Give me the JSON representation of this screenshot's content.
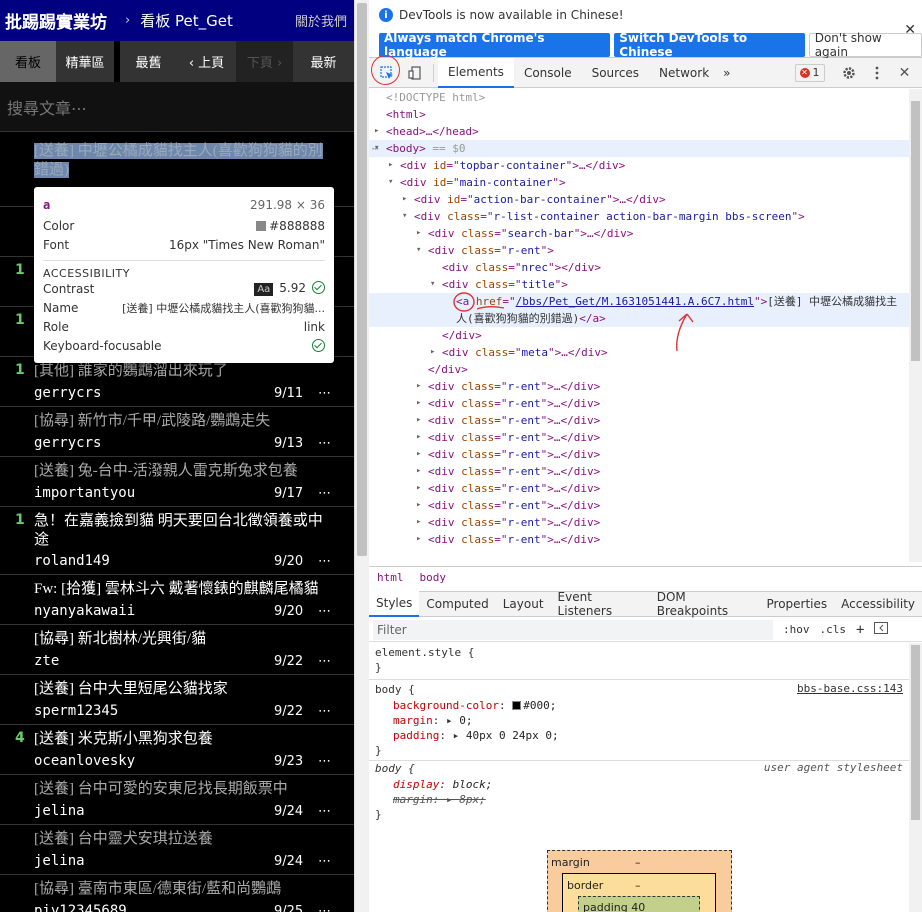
{
  "ptt": {
    "site_name": "批踢踢實業坊",
    "separator": "›",
    "board_label": "看板 Pet_Get",
    "about": "關於我們",
    "actions": {
      "board": "看板",
      "digest": "精華區",
      "oldest": "最舊",
      "prev": "‹ 上頁",
      "next": "下頁 ›",
      "latest": "最新"
    },
    "search_placeholder": "搜尋文章⋯",
    "more_symbol": "⋯",
    "highlight_title": "[送養] 中壢公橘成貓找主人(喜歡狗狗貓的別錯過)",
    "rows": [
      {
        "nrec": "1",
        "nrec_color": "#6c6",
        "title": "",
        "author": "",
        "date": ""
      },
      {
        "nrec": "1",
        "nrec_color": "#6c6",
        "title": "",
        "author": "",
        "date": ""
      },
      {
        "nrec": "1",
        "nrec_color": "#6c6",
        "title": "[其他] 誰家的鸚鵡溜出來玩了",
        "author": "gerrycrs",
        "date": "9/11"
      },
      {
        "nrec": "",
        "nrec_color": "#6c6",
        "title": "[協尋] 新竹市/千甲/武陵路/鸚鵡走失",
        "author": "gerrycrs",
        "date": "9/13"
      },
      {
        "nrec": "",
        "nrec_color": "#6c6",
        "title": "[送養] 兔-台中-活潑親人雷克斯兔求包養",
        "author": "importantyou",
        "date": "9/17"
      },
      {
        "nrec": "1",
        "nrec_color": "#6c6",
        "title": "急！在嘉義撿到貓 明天要回台北徵領養或中途",
        "author": "roland149",
        "date": "9/20",
        "bright": true
      },
      {
        "nrec": "",
        "nrec_color": "#6c6",
        "title": "Fw: [拾獲] 雲林斗六 戴著懷錶的麒麟尾橘貓",
        "author": "nyanyakawaii",
        "date": "9/20",
        "bright": true
      },
      {
        "nrec": "",
        "nrec_color": "#6c6",
        "title": "[協尋] 新北樹林/光興街/貓",
        "author": "zte",
        "date": "9/22",
        "bright": true
      },
      {
        "nrec": "",
        "nrec_color": "#6c6",
        "title": "[送養] 台中大里短尾公貓找家",
        "author": "sperm12345",
        "date": "9/22",
        "bright": true
      },
      {
        "nrec": "4",
        "nrec_color": "#6c6",
        "title": "[送養] 米克斯小黑狗求包養",
        "author": "oceanlovesky",
        "date": "9/23",
        "bright": true
      },
      {
        "nrec": "",
        "nrec_color": "#6c6",
        "title": "[送養] 台中可愛的安東尼找長期飯票中",
        "author": "jelina",
        "date": "9/24"
      },
      {
        "nrec": "",
        "nrec_color": "#6c6",
        "title": "[送養] 台中靈犬安琪拉送養",
        "author": "jelina",
        "date": "9/24"
      },
      {
        "nrec": "",
        "nrec_color": "#6c6",
        "title": "[協尋] 臺南市東區/德東街/藍和尚鸚鵡",
        "author": "piy12345689",
        "date": "9/25"
      }
    ],
    "tooltip": {
      "tag": "a",
      "size": "291.98 × 36",
      "color_label": "Color",
      "color_value": "#888888",
      "font_label": "Font",
      "font_value": "16px \"Times New Roman\"",
      "section": "ACCESSIBILITY",
      "contrast_label": "Contrast",
      "contrast_aa": "Aa",
      "contrast_value": "5.92",
      "name_label": "Name",
      "name_value": "[送養] 中壢公橘成貓找主人(喜歡狗狗貓...",
      "role_label": "Role",
      "role_value": "link",
      "keyboard_label": "Keyboard-focusable"
    }
  },
  "devtools": {
    "info_message": "DevTools is now available in Chinese!",
    "btn_match": "Always match Chrome's language",
    "btn_switch": "Switch DevTools to Chinese",
    "btn_dont_show": "Don't show again",
    "tabs": [
      "Elements",
      "Console",
      "Sources",
      "Network"
    ],
    "more_tabs": "»",
    "error_count": "1",
    "dom": {
      "doctype": "<!DOCTYPE html>",
      "html_open": "<html>",
      "head": "<head>…</head>",
      "body_open": "<body>",
      "body_eq": "== $0",
      "topbar": [
        "<div ",
        "id",
        "=\"",
        "topbar-container",
        "\">…</div>"
      ],
      "main": [
        "<div ",
        "id",
        "=\"",
        "main-container",
        "\">"
      ],
      "actionbar": [
        "<div ",
        "id",
        "=\"",
        "action-bar-container",
        "\">…</div>"
      ],
      "rlist": [
        "<div ",
        "class",
        "=\"",
        "r-list-container action-bar-margin bbs-screen",
        "\">"
      ],
      "searchbar": [
        "<div ",
        "class",
        "=\"",
        "search-bar",
        "\">…</div>"
      ],
      "rent_open": [
        "<div ",
        "class",
        "=\"",
        "r-ent",
        "\">"
      ],
      "nrec": [
        "<div ",
        "class",
        "=\"",
        "nrec",
        "\"></div>"
      ],
      "title_div": [
        "<div ",
        "class",
        "=\"",
        "title",
        "\">"
      ],
      "a_href_attr": "href",
      "a_href_value": "/bbs/Pet_Get/M.1631051441.A.6C7.html",
      "a_text_1": "[送養] 中壢公橘成貓找主",
      "a_text_2": "人(喜歡狗狗貓的別錯過)",
      "div_close": "</div>",
      "meta": [
        "<div ",
        "class",
        "=\"",
        "meta",
        "\">…</div>"
      ],
      "rent_collapsed": [
        "<div ",
        "class",
        "=\"",
        "r-ent",
        "\">…</div>"
      ]
    },
    "crumbs": [
      "html",
      "body"
    ],
    "style_tabs": [
      "Styles",
      "Computed",
      "Layout",
      "Event Listeners",
      "DOM Breakpoints",
      "Properties",
      "Accessibility"
    ],
    "filter_placeholder": "Filter",
    "hov": ":hov",
    "cls": ".cls",
    "plus": "+",
    "styles": {
      "element_style": "element.style {",
      "brace_close": "}",
      "body_selector": "body {",
      "body_source": "bbs-base.css:143",
      "bg_prop": "background-color",
      "bg_val": "#000;",
      "margin_prop": "margin",
      "margin_val": "0;",
      "padding_prop": "padding",
      "padding_val": "40px 0 24px 0;",
      "ua_selector": "body {",
      "ua_source": "user agent stylesheet",
      "display_prop": "display",
      "display_val": "block;",
      "ua_margin_prop": "margin",
      "ua_margin_val": "8px;"
    },
    "boxmodel": {
      "margin_label": "margin",
      "margin_val": "–",
      "border_label": "border",
      "border_val": "–",
      "padding_label": "padding 40"
    }
  }
}
